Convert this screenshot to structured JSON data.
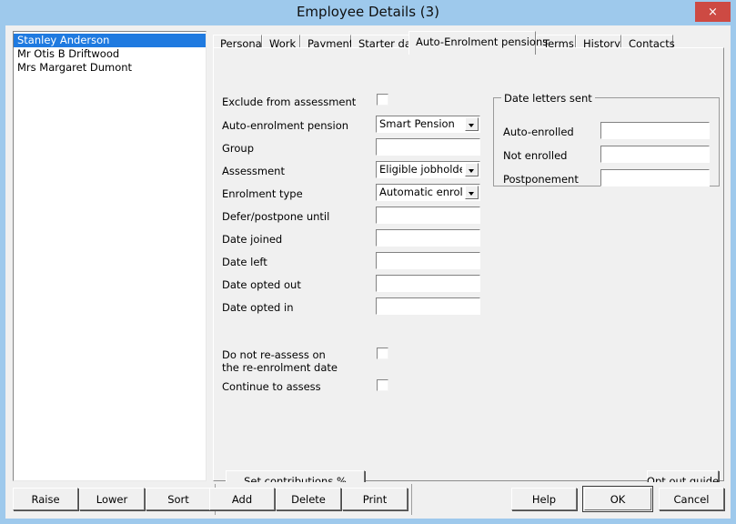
{
  "window": {
    "title": "Employee Details (3)",
    "close_label": "×",
    "titlebar_color": "#9ec9ec",
    "accent_color": "#cd4a43",
    "selection_color": "#1f7ae0",
    "face_color": "#f0f0f0"
  },
  "employee_list": {
    "items": [
      {
        "label": "Stanley Anderson",
        "selected": true
      },
      {
        "label": "Mr Otis B Driftwood",
        "selected": false
      },
      {
        "label": "Mrs Margaret Dumont",
        "selected": false
      }
    ]
  },
  "tabs": [
    {
      "label": "Personal",
      "active": false
    },
    {
      "label": "Work",
      "active": false
    },
    {
      "label": "Payment",
      "active": false
    },
    {
      "label": "Starter data",
      "active": false
    },
    {
      "label": "Auto-Enrolment pensions",
      "active": true
    },
    {
      "label": "Terms",
      "active": false
    },
    {
      "label": "History",
      "active": false
    },
    {
      "label": "Contacts",
      "active": false
    }
  ],
  "form": {
    "exclude_from_assessment": {
      "label": "Exclude from assessment",
      "checked": false
    },
    "auto_enrolment_pension": {
      "label": "Auto-enrolment pension",
      "value": "Smart Pension"
    },
    "group": {
      "label": "Group",
      "value": ""
    },
    "assessment": {
      "label": "Assessment",
      "value": "Eligible jobholder"
    },
    "enrolment_type": {
      "label": "Enrolment type",
      "value": "Automatic enrolmer"
    },
    "defer_postpone_until": {
      "label": "Defer/postpone until",
      "value": ""
    },
    "date_joined": {
      "label": "Date joined",
      "value": ""
    },
    "date_left": {
      "label": "Date left",
      "value": ""
    },
    "date_opted_out": {
      "label": "Date opted out",
      "value": ""
    },
    "date_opted_in": {
      "label": "Date opted in",
      "value": ""
    },
    "do_not_reassess": {
      "label_line1": "Do not re-assess on",
      "label_line2": "the re-enrolment date",
      "checked": false
    },
    "continue_to_assess": {
      "label": "Continue to assess",
      "checked": false
    }
  },
  "date_letters_sent": {
    "title": "Date letters sent",
    "auto_enrolled": {
      "label": "Auto-enrolled",
      "value": ""
    },
    "not_enrolled": {
      "label": "Not enrolled",
      "value": ""
    },
    "postponement": {
      "label": "Postponement",
      "value": ""
    }
  },
  "panel_buttons": {
    "set_contributions": "Set contributions %",
    "opt_out_guide": "Opt out guide"
  },
  "bottom_buttons": {
    "raise": "Raise",
    "lower": "Lower",
    "sort": "Sort",
    "add": "Add",
    "delete": "Delete",
    "print": "Print",
    "help": "Help",
    "ok": "OK",
    "cancel": "Cancel"
  }
}
